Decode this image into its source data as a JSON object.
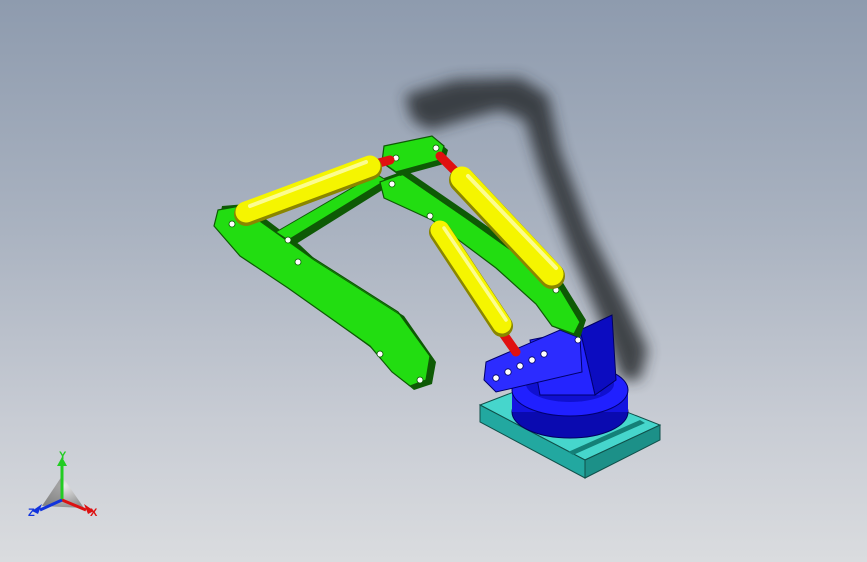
{
  "colors": {
    "background_top": "#8e9bae",
    "background_bottom": "#dadcdf",
    "arm": "#22dd11",
    "arm_edge": "#0e5a05",
    "cylinder": "#f5f500",
    "rod": "#e01010",
    "base": "#1010ee",
    "plate": "#2ec8c0",
    "shadow": "#2a2d33"
  },
  "triad": {
    "x_label": "X",
    "y_label": "Y",
    "z_label": "Z",
    "x_color": "#dd1111",
    "y_color": "#22cc22",
    "z_color": "#1133dd"
  }
}
